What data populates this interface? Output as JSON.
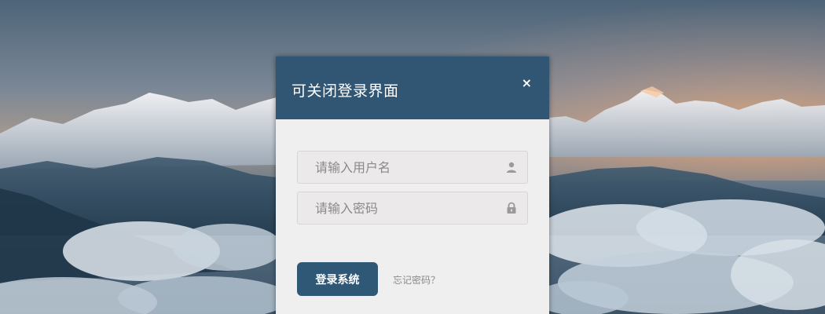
{
  "dialog": {
    "title": "可关闭登录界面",
    "close_glyph": "×"
  },
  "username": {
    "placeholder": "请输入用户名",
    "value": "",
    "icon": "user-icon"
  },
  "password": {
    "placeholder": "请输入密码",
    "value": "",
    "icon": "lock-icon"
  },
  "actions": {
    "login_label": "登录系统",
    "forgot_label": "忘记密码？"
  },
  "colors": {
    "header": "#305674",
    "button": "#2f5877",
    "panel": "#efefef"
  }
}
